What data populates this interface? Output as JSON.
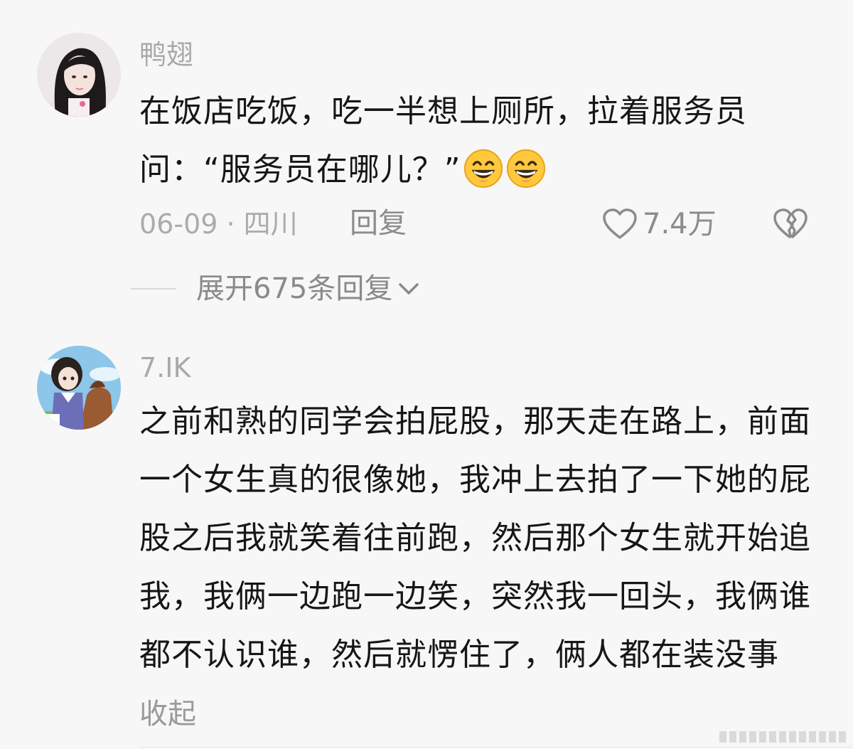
{
  "comments": [
    {
      "username": "鸭翅",
      "avatar_icon": "avatar-girl-photo-icon",
      "text": "在饭店吃饭，吃一半想上厕所，拉着服务员问：“服务员在哪儿？”",
      "emoji_icon": "grinning-face-icon",
      "emoji_count": 2,
      "date_location": "06-09 · 四川",
      "reply_label": "回复",
      "like_count": "7.4万",
      "expand_label": "展开675条回复"
    },
    {
      "username": "7.IK",
      "avatar_icon": "avatar-anime-girl-with-horse-icon",
      "text": "之前和熟的同学会拍屁股，那天走在路上，前面一个女生真的很像她，我冲上去拍了一下她的屁股之后我就笑着往前跑，然后那个女生就开始追我，我俩一边跑一边笑，突然我一回头，我俩谁都不认识谁，然后就愣住了，俩人都在装没事",
      "collapse_label": "收起"
    }
  ],
  "colors": {
    "background": "#f7f7f7",
    "text": "#161616",
    "muted": "#ababab",
    "emoji_yellow": "#ffc83d"
  }
}
